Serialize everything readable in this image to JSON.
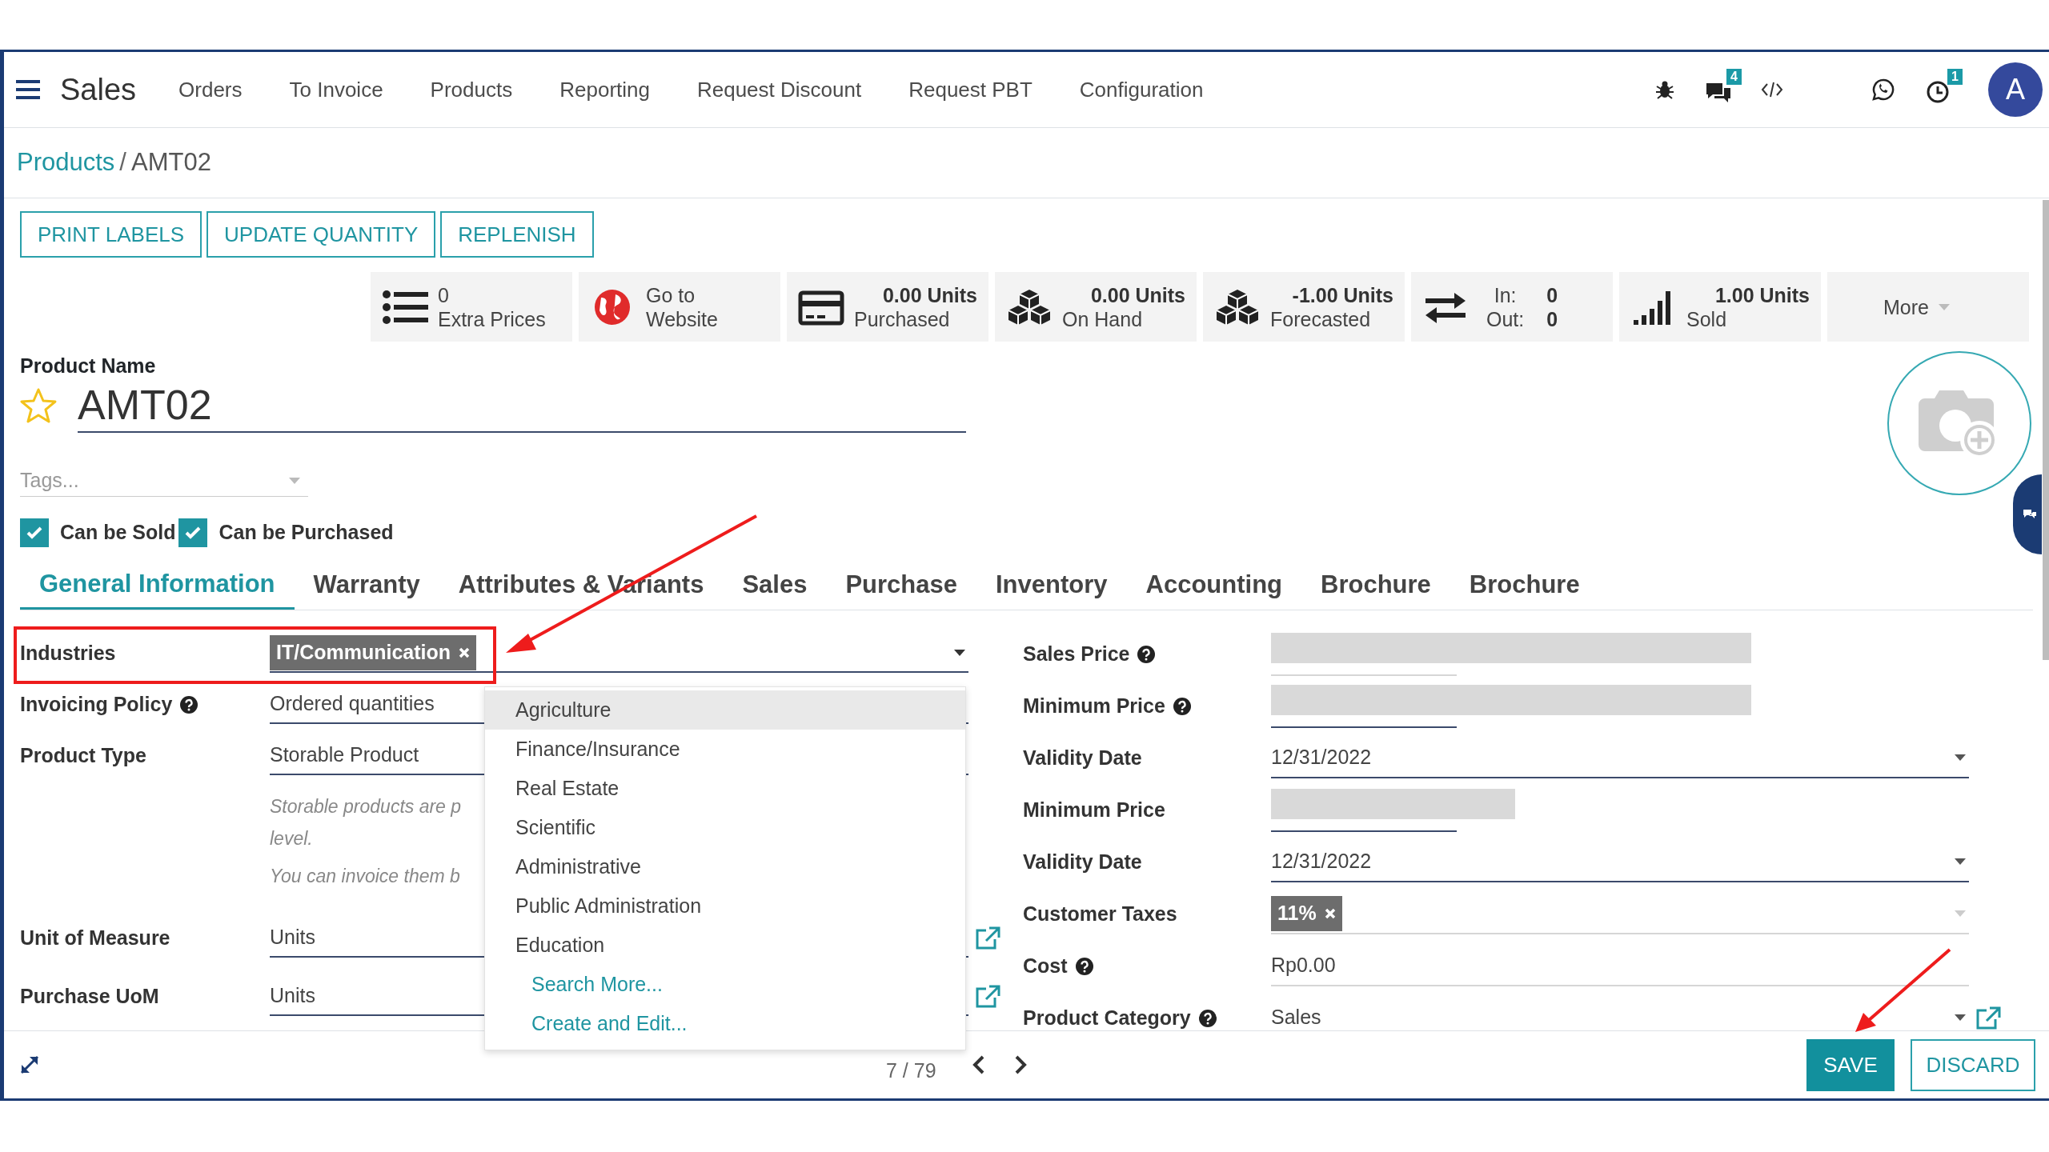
{
  "navbar": {
    "app_name": "Sales",
    "menu": [
      "Orders",
      "To Invoice",
      "Products",
      "Reporting",
      "Request Discount",
      "Request PBT",
      "Configuration"
    ],
    "messages_count": "4",
    "activities_count": "1",
    "avatar_initial": "A"
  },
  "breadcrumb": {
    "parent": "Products",
    "separator": "/",
    "current": "AMT02"
  },
  "action_buttons": [
    "PRINT LABELS",
    "UPDATE QUANTITY",
    "REPLENISH"
  ],
  "stat_buttons": [
    {
      "kind": "text",
      "value": "0",
      "label": "Extra Prices"
    },
    {
      "kind": "text",
      "value": "Go to",
      "label": "Website"
    },
    {
      "kind": "quantity",
      "value": "0.00 Units",
      "label": "Purchased"
    },
    {
      "kind": "quantity",
      "value": "0.00 Units",
      "label": "On Hand"
    },
    {
      "kind": "quantity",
      "value": "-1.00 Units",
      "label": "Forecasted"
    },
    {
      "kind": "inout",
      "rows": [
        {
          "label": "In:",
          "value": "0"
        },
        {
          "label": "Out:",
          "value": "0"
        }
      ]
    },
    {
      "kind": "quantity",
      "value": "1.00 Units",
      "label": "Sold"
    },
    {
      "kind": "more",
      "label": "More"
    }
  ],
  "product": {
    "name_label": "Product Name",
    "name": "AMT02",
    "favorite": false,
    "tags_placeholder": "Tags..."
  },
  "options": [
    {
      "label": "Can be Sold",
      "checked": true
    },
    {
      "label": "Can be Purchased",
      "checked": true
    }
  ],
  "tabs": [
    {
      "label": "General Information",
      "selected": true
    },
    {
      "label": "Warranty",
      "selected": false
    },
    {
      "label": "Attributes & Variants",
      "selected": false
    },
    {
      "label": "Sales",
      "selected": false
    },
    {
      "label": "Purchase",
      "selected": false
    },
    {
      "label": "Inventory",
      "selected": false
    },
    {
      "label": "Accounting",
      "selected": false
    },
    {
      "label": "Brochure",
      "selected": false
    },
    {
      "label": "Brochure",
      "selected": false
    }
  ],
  "left_fields": [
    {
      "label": "Industries",
      "help": false,
      "highlighted": true,
      "kind": "tags",
      "tags": [
        "IT/Communication"
      ]
    },
    {
      "label": "Invoicing Policy",
      "help": true,
      "highlighted": false,
      "kind": "select",
      "value": "Ordered quantities"
    },
    {
      "label": "Product Type",
      "help": false,
      "highlighted": false,
      "kind": "select",
      "value": "Storable Product",
      "notes": [
        "Storable products are p",
        "level.",
        "You can invoice them b"
      ]
    },
    {
      "label": "Unit of Measure",
      "help": false,
      "highlighted": false,
      "kind": "link",
      "value": "Units"
    },
    {
      "label": "Purchase UoM",
      "help": false,
      "highlighted": false,
      "kind": "link",
      "value": "Units"
    }
  ],
  "dropdown": {
    "items": [
      {
        "label": "Agriculture",
        "selected": true
      },
      {
        "label": "Finance/Insurance",
        "selected": false
      },
      {
        "label": "Real Estate",
        "selected": false
      },
      {
        "label": "Scientific",
        "selected": false
      },
      {
        "label": "Administrative",
        "selected": false
      },
      {
        "label": "Public Administration",
        "selected": false
      },
      {
        "label": "Education",
        "selected": false
      }
    ],
    "actions": [
      "Search More...",
      "Create and Edit..."
    ]
  },
  "right_fields": [
    {
      "label": "Sales Price",
      "help": true,
      "required": false,
      "kind": "redacted",
      "short": false
    },
    {
      "label": "Minimum Price",
      "help": true,
      "required": true,
      "kind": "redacted",
      "short": false
    },
    {
      "label": "Validity Date",
      "help": false,
      "required": true,
      "kind": "date",
      "value": "12/31/2022"
    },
    {
      "label": "Minimum Price",
      "help": false,
      "required": true,
      "kind": "redacted",
      "short": true
    },
    {
      "label": "Validity Date",
      "help": false,
      "required": true,
      "kind": "date",
      "value": "12/31/2022"
    },
    {
      "label": "Customer Taxes",
      "help": false,
      "required": false,
      "kind": "tags",
      "tags": [
        "11%"
      ]
    },
    {
      "label": "Cost",
      "help": true,
      "required": false,
      "kind": "text",
      "value": "Rp0.00"
    },
    {
      "label": "Product Category",
      "help": true,
      "required": false,
      "kind": "link",
      "value": "Sales"
    }
  ],
  "footer": {
    "pager": "7 / 79",
    "save": "SAVE",
    "discard": "DISCARD"
  }
}
